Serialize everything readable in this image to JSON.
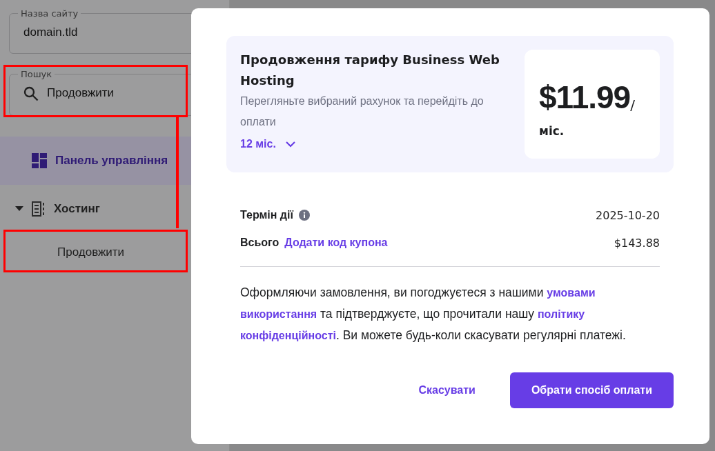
{
  "sidebar": {
    "site_field": {
      "label": "Назва сайту",
      "value": "domain.tld"
    },
    "search_field": {
      "label": "Пошук",
      "value": "Продовжити"
    },
    "nav": [
      {
        "label": "Панель управління",
        "kind": "dashboard",
        "selected": true
      },
      {
        "label": "Хостинг",
        "kind": "hosting",
        "selected": false,
        "expanded": true,
        "children": [
          {
            "label": "Продовжити",
            "selected": false
          }
        ]
      }
    ]
  },
  "modal": {
    "plan": {
      "title": "Продовження тарифу Business Web Hosting",
      "subtitle": "Перегляньте вибраний рахунок та перейдіть до оплати",
      "period": "12 міс.",
      "price": "$11.99",
      "slash": "/",
      "unit": "міс."
    },
    "details": [
      {
        "kind": "info",
        "label": "Термін дії",
        "value": "2025-10-20"
      },
      {
        "kind": "coupon",
        "label": "Всього",
        "link": "Додати код купона",
        "value": "$143.88"
      }
    ],
    "terms": [
      {
        "kind": "text",
        "text": "Оформляючи замовлення, ви погоджуєтеся з нашими "
      },
      {
        "kind": "link",
        "text": "умовами використання"
      },
      {
        "kind": "text",
        "text": " та підтверджуєте, що прочитали нашу "
      },
      {
        "kind": "link",
        "text": "політику конфіденційності"
      },
      {
        "kind": "text",
        "text": ". Ви можете будь-коли скасувати регулярні платежі."
      }
    ],
    "buttons": [
      {
        "kind": "secondary",
        "label": "Скасувати"
      },
      {
        "kind": "primary",
        "label": "Обрати спосіб оплати"
      }
    ]
  }
}
